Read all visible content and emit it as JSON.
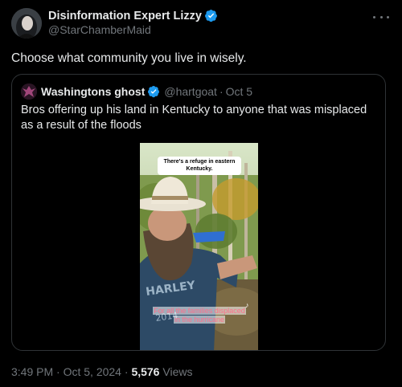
{
  "author": {
    "display_name": "Disinformation Expert Lizzy",
    "handle": "@StarChamberMaid",
    "verified_color": "#1d9bf0"
  },
  "tweet": {
    "text": "Choose what community you live in wisely."
  },
  "quote": {
    "display_name": "Washingtons ghost",
    "handle": "@hartgoat",
    "separator": "·",
    "time": "Oct 5",
    "text": "Bros offering up his land in Kentucky to anyone that was misplaced as a result of the floods",
    "video": {
      "caption_top": "There's a refuge in eastern Kentucky.",
      "caption_bottom_line1": "For all the families displaced",
      "caption_bottom_line2": "in the hurricane",
      "watermark_icon": "tiktok-icon"
    }
  },
  "meta": {
    "time": "3:49 PM",
    "separator": " · ",
    "date": "Oct 5, 2024",
    "views_count": "5,576",
    "views_label": " Views"
  },
  "icons": {
    "more": "more-icon",
    "verified": "verified-badge-icon"
  }
}
